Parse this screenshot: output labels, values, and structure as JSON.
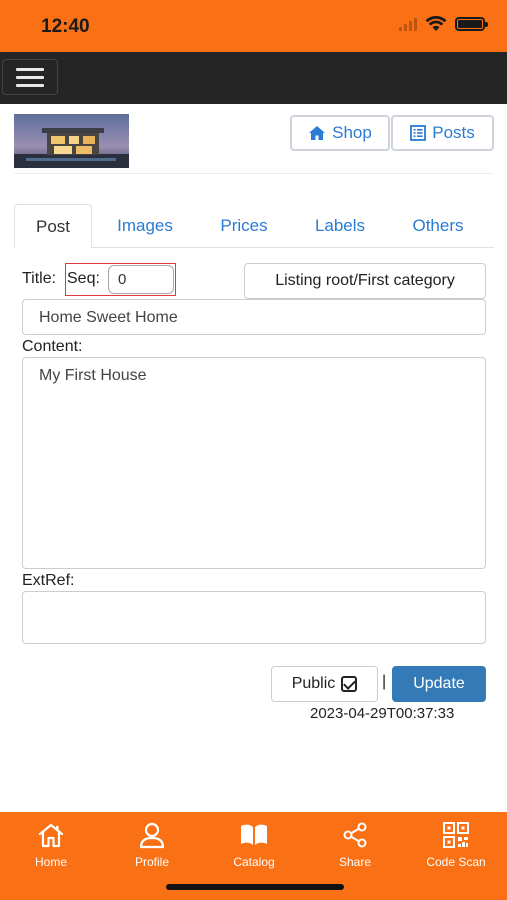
{
  "status_bar": {
    "time": "12:40"
  },
  "header": {
    "shop_label": "Shop",
    "posts_label": "Posts"
  },
  "tabs": [
    {
      "label": "Post",
      "active": true
    },
    {
      "label": "Images",
      "active": false
    },
    {
      "label": "Prices",
      "active": false
    },
    {
      "label": "Labels",
      "active": false
    },
    {
      "label": "Others",
      "active": false
    }
  ],
  "form": {
    "title_label": "Title:",
    "seq_label": "Seq:",
    "seq_value": "0",
    "category_button": "Listing root/First category",
    "title_value": "Home Sweet Home",
    "content_label": "Content:",
    "content_value": "My First House",
    "extref_label": "ExtRef:",
    "extref_value": "",
    "public_label": "Public",
    "separator": "|",
    "update_label": "Update",
    "timestamp": "2023-04-29T00:37:33"
  },
  "bottom_nav": [
    {
      "label": "Home",
      "icon": "home-icon"
    },
    {
      "label": "Profile",
      "icon": "user-icon"
    },
    {
      "label": "Catalog",
      "icon": "book-icon"
    },
    {
      "label": "Share",
      "icon": "share-icon"
    },
    {
      "label": "Code Scan",
      "icon": "qr-code-icon"
    }
  ],
  "colors": {
    "accent": "#fa7014",
    "nav_dark": "#252525",
    "link_blue": "#2a7bd4",
    "primary_button": "#337ab7"
  }
}
